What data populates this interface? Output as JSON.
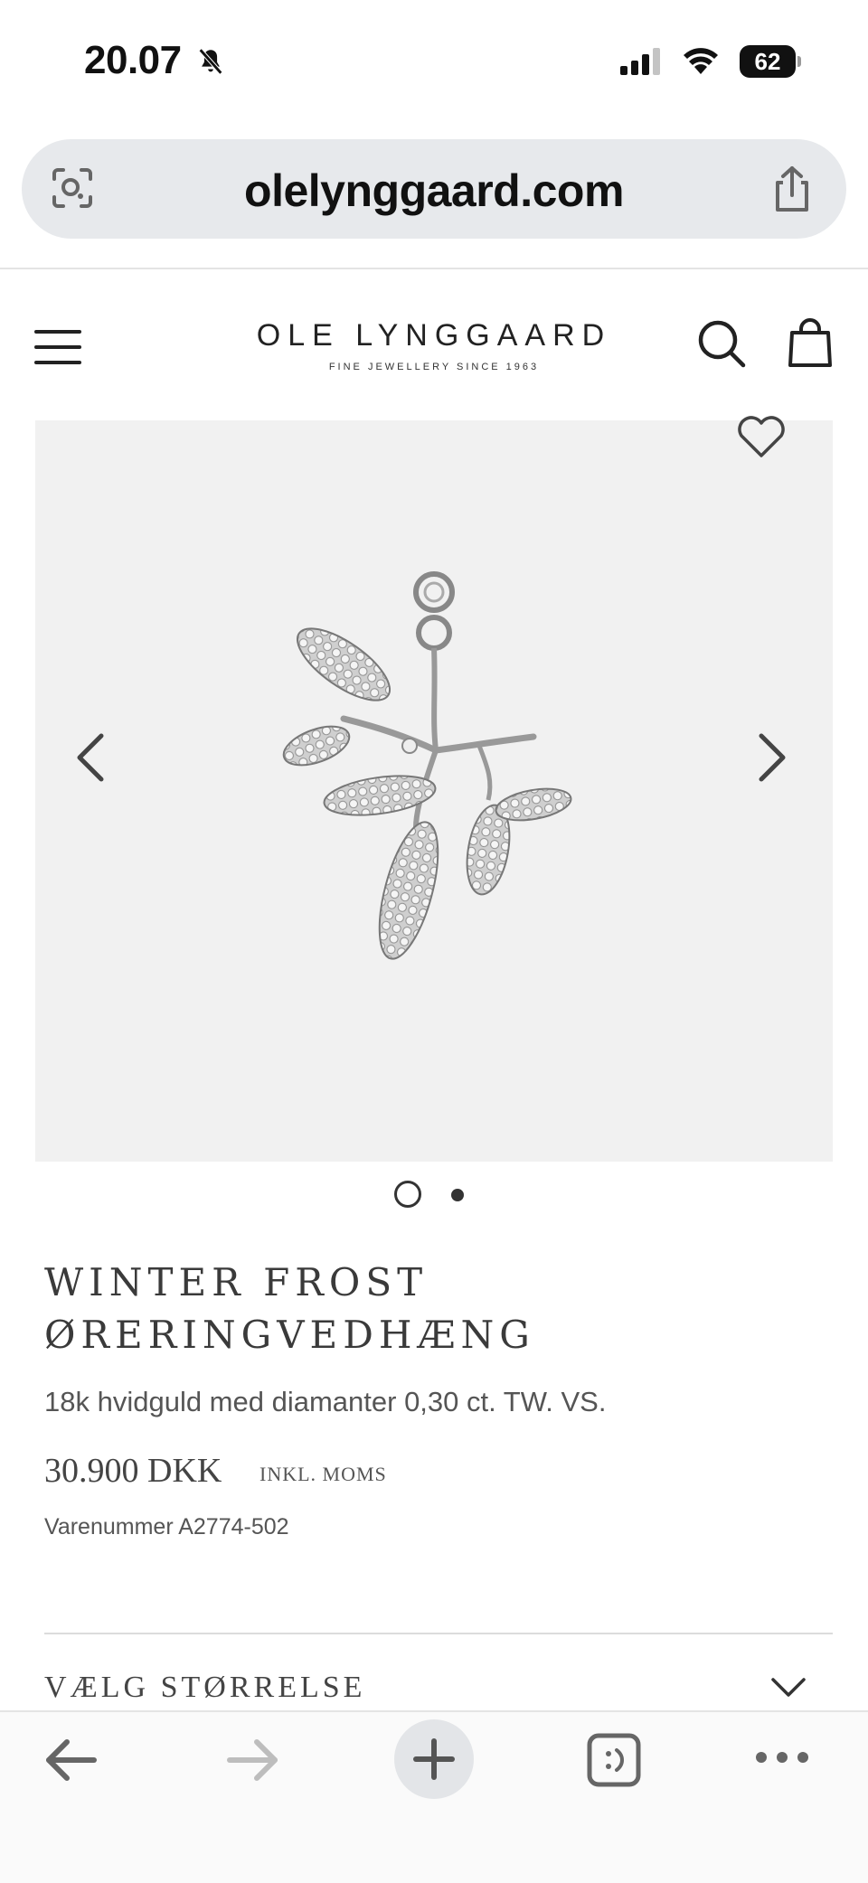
{
  "status_bar": {
    "time": "20.07",
    "battery": "62"
  },
  "browser": {
    "url": "olelynggaard.com"
  },
  "site_header": {
    "logo_main": "OLE LYNGGAARD",
    "logo_sub": "FINE JEWELLERY SINCE 1963"
  },
  "product": {
    "title_line1": "WINTER FROST",
    "title_line2": "ØRERINGVEDHÆNG",
    "description": "18k hvidguld med diamanter 0,30 ct. TW. VS.",
    "price": "30.900 DKK",
    "vat_note": "INKL. MOMS",
    "sku": "Varenummer A2774-502",
    "gallery": {
      "current": 1,
      "total": 2
    }
  },
  "size_selector": {
    "label": "VÆLG STØRRELSE"
  },
  "icons": {
    "status": [
      "bell-muted-icon",
      "signal-icon",
      "wifi-icon",
      "battery-icon"
    ],
    "url_bar": [
      "lens-icon",
      "share-icon"
    ],
    "header": [
      "menu-icon",
      "search-icon",
      "bag-icon"
    ],
    "product": [
      "heart-icon",
      "chevron-left-icon",
      "chevron-right-icon"
    ],
    "toolbar": [
      "back-arrow-icon",
      "forward-arrow-icon",
      "plus-icon",
      "tabs-icon",
      "more-icon"
    ]
  }
}
